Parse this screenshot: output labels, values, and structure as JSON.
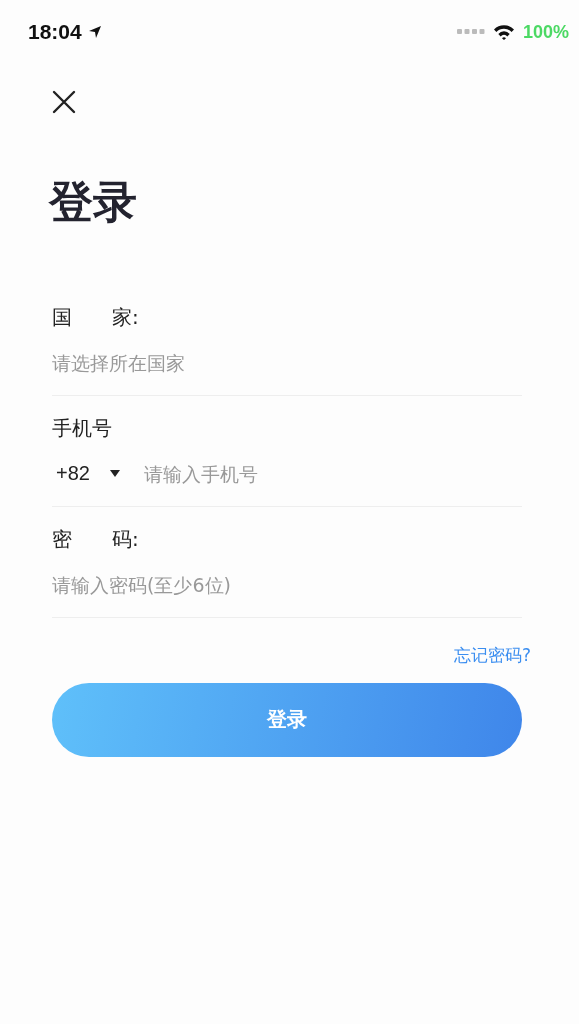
{
  "status_bar": {
    "time": "18:04",
    "battery": "100%"
  },
  "title": "登录",
  "fields": [
    {
      "kind": "select",
      "label": "国　　家:",
      "placeholder": "请选择所在国家"
    },
    {
      "kind": "phone",
      "label": "手机号",
      "code": "+82",
      "placeholder": "请输入手机号"
    },
    {
      "kind": "password",
      "label": "密　　码:",
      "placeholder": "请输入密码(至少6位)"
    }
  ],
  "forgot_link": "忘记密码?",
  "login_button": "登录"
}
